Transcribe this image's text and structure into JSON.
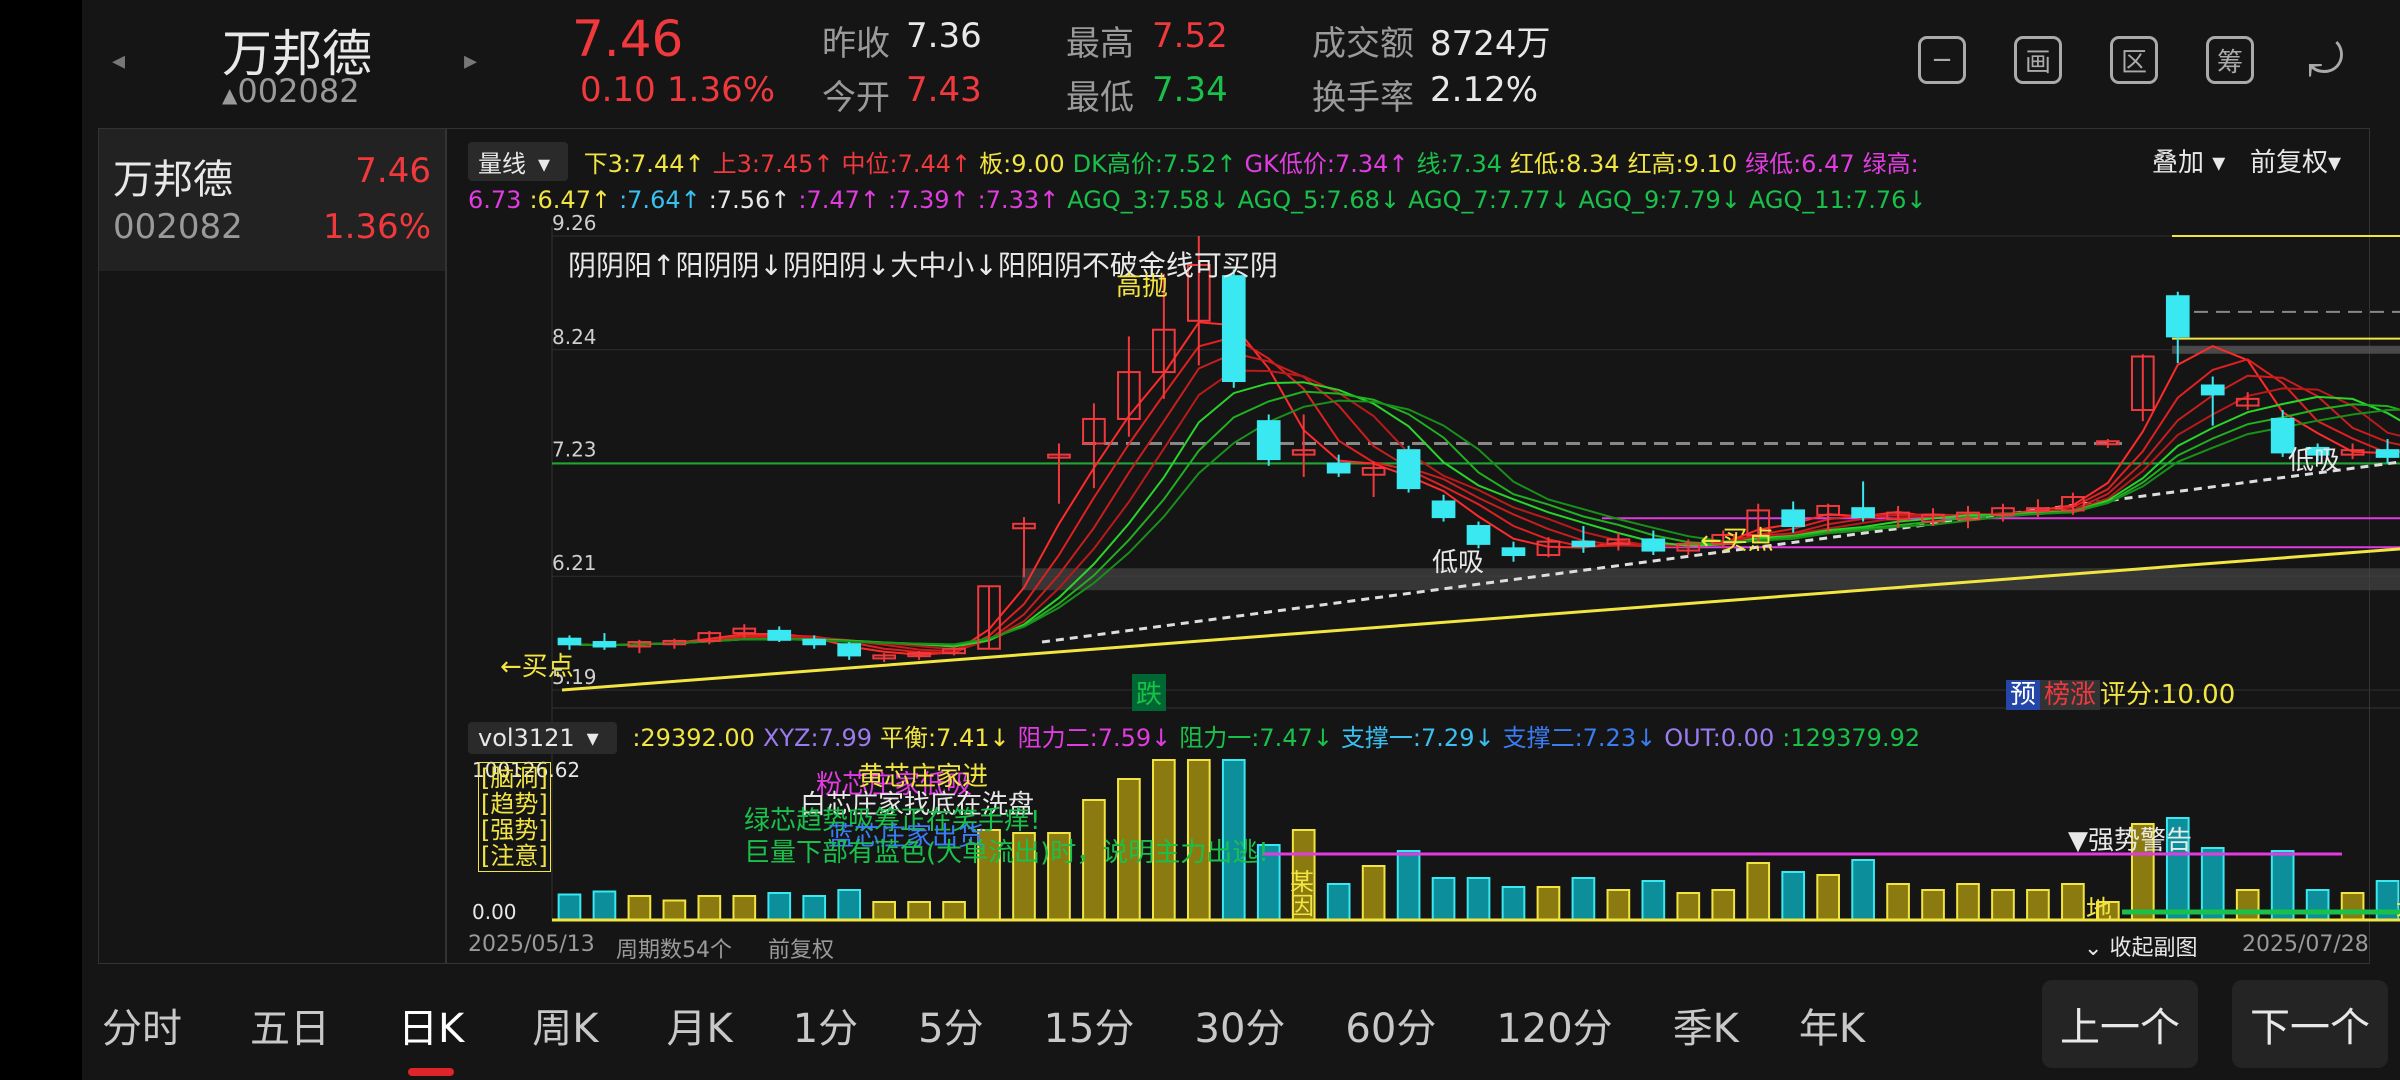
{
  "header": {
    "stock_name": "万邦德",
    "stock_code": "002082",
    "price": "7.46",
    "change": "0.10",
    "change_pct": "1.36%",
    "prev_close_label": "昨收",
    "prev_close": "7.36",
    "open_label": "今开",
    "open": "7.43",
    "high_label": "最高",
    "high": "7.52",
    "low_label": "最低",
    "low": "7.34",
    "turnover_label": "成交额",
    "turnover": "8724万",
    "turnover_rate_label": "换手率",
    "turnover_rate": "2.12%",
    "toolbar_icons": [
      {
        "name": "collapse-icon",
        "glyph": "−"
      },
      {
        "name": "draw-icon",
        "glyph": "画"
      },
      {
        "name": "range-icon",
        "glyph": "区"
      },
      {
        "name": "chip-icon",
        "glyph": "筹"
      },
      {
        "name": "rotate-screen-icon",
        "glyph": "⤾"
      }
    ]
  },
  "watchlist": {
    "items": [
      {
        "name": "万邦德",
        "code": "002082",
        "price": "7.46",
        "change_pct": "1.36%"
      }
    ]
  },
  "main_chart": {
    "indicator_selector": "量线",
    "overlay_label": "叠加",
    "adjust_label": "前复权",
    "line1": [
      {
        "text": "下3:7.44↑",
        "color": "#f2e542"
      },
      {
        "text": "上3:7.45↑",
        "color": "#f0393d"
      },
      {
        "text": "中位:7.44↑",
        "color": "#f0393d"
      },
      {
        "text": "板:9.00",
        "color": "#f2e542"
      },
      {
        "text": "DK高价:7.52↑",
        "color": "#19c14a"
      },
      {
        "text": "GK低价:7.34↑",
        "color": "#e03ce0"
      },
      {
        "text": "线:7.34",
        "color": "#19c14a"
      },
      {
        "text": "红低:8.34",
        "color": "#f2e542"
      },
      {
        "text": "红高:9.10",
        "color": "#f2e542"
      },
      {
        "text": "绿低:6.47",
        "color": "#e03ce0"
      },
      {
        "text": "绿高:",
        "color": "#e03ce0"
      }
    ],
    "line2": [
      {
        "text": "6.73",
        "color": "#e03ce0"
      },
      {
        "text": ":6.47↑",
        "color": "#f2e542"
      },
      {
        "text": ":7.64↑",
        "color": "#39c0f0"
      },
      {
        "text": ":7.56↑",
        "color": "#e8e8e8"
      },
      {
        "text": ":7.47↑",
        "color": "#e03ce0"
      },
      {
        "text": ":7.39↑",
        "color": "#e03ce0"
      },
      {
        "text": ":7.33↑",
        "color": "#e03ce0"
      },
      {
        "text": "AGQ_3:7.58↓",
        "color": "#19c14a"
      },
      {
        "text": "AGQ_5:7.68↓",
        "color": "#19c14a"
      },
      {
        "text": "AGQ_7:7.77↓",
        "color": "#19c14a"
      },
      {
        "text": "AGQ_9:7.79↓",
        "color": "#19c14a"
      },
      {
        "text": "AGQ_11:7.76↓",
        "color": "#19c14a"
      }
    ],
    "y_ticks": [
      "9.26",
      "8.24",
      "7.23",
      "6.21",
      "5.19"
    ],
    "annotation_top": "阴阴阳↑阳阴阴↓阴阳阴↓大中小↓阳阳阴不破金线可买阴",
    "label_high_throw": "高抛",
    "label_low_buy": "低吸",
    "label_low_buy_right": "低吸",
    "label_buy1": "←买点",
    "label_buy2": "←买点",
    "label_fall": "跌",
    "label_pre": "预",
    "label_rank": "榜涨",
    "score_label": "评分:",
    "score": "10.00"
  },
  "sub_chart": {
    "selector": "vol3121",
    "values": [
      {
        "text": ":29392.00",
        "color": "#f2e542"
      },
      {
        "text": "XYZ:7.99",
        "color": "#9b7cf0"
      },
      {
        "text": "平衡:7.41↓",
        "color": "#f2e542"
      },
      {
        "text": "阻力二:7.59↓",
        "color": "#e03ce0"
      },
      {
        "text": "阻力一:7.47↓",
        "color": "#19c14a"
      },
      {
        "text": "支撑一:7.29↓",
        "color": "#39c0f0"
      },
      {
        "text": "支撑二:7.23↓",
        "color": "#3a7cf3"
      },
      {
        "text": "OUT:0.00",
        "color": "#9b7cf0"
      },
      {
        "text": ":129379.92",
        "color": "#19c14a"
      }
    ],
    "y_top": "100126.62",
    "y_bottom": "0.00",
    "legend_box": [
      "[脑洞]",
      "[趋势]",
      "[强势]",
      "[注意]"
    ],
    "note_yellow": "黄芯庄家进",
    "note_magenta": "粉芯庄家低吸",
    "note_white": "白芯庄家找底在洗盘",
    "note_green1": "绿芯趋势吸筹正在笑手痒!",
    "note_blue": "蓝芯庄家出货",
    "note_green2": "巨量下部有蓝色(大单流出)时，说明主力出逃!",
    "label_strong_warning": "▼强势警告",
    "label_di1": "地",
    "label_di2": "地",
    "label_special": "某",
    "label_special2": "因"
  },
  "footer_row": {
    "start_date": "2025/05/13",
    "period_count": "周期数54个",
    "adjust": "前复权",
    "collapse_sub": "收起副图",
    "end_date": "2025/07/28"
  },
  "tabs": {
    "items": [
      "分时",
      "五日",
      "日K",
      "周K",
      "月K",
      "1分",
      "5分",
      "15分",
      "30分",
      "60分",
      "120分",
      "季K",
      "年K"
    ],
    "active": "日K",
    "prev_label": "上一个",
    "next_label": "下一个"
  },
  "colors": {
    "up": "#f0393d",
    "down": "#19c14a",
    "accent_yellow": "#f2e542",
    "cyan": "#39e8f0",
    "background": "#151515"
  },
  "chart_data": {
    "type": "bar",
    "title": "",
    "ylim": [
      5.19,
      9.26
    ],
    "x_range": [
      "2025/05/13",
      "2025/07/28"
    ],
    "y_ticks": [
      9.26,
      8.24,
      7.23,
      6.21,
      5.19
    ],
    "candles": [
      {
        "o": 5.65,
        "h": 5.68,
        "l": 5.55,
        "c": 5.6,
        "up": false
      },
      {
        "o": 5.62,
        "h": 5.7,
        "l": 5.55,
        "c": 5.58,
        "up": false
      },
      {
        "o": 5.58,
        "h": 5.64,
        "l": 5.52,
        "c": 5.62,
        "up": true
      },
      {
        "o": 5.6,
        "h": 5.65,
        "l": 5.56,
        "c": 5.63,
        "up": true
      },
      {
        "o": 5.63,
        "h": 5.72,
        "l": 5.6,
        "c": 5.7,
        "up": true
      },
      {
        "o": 5.7,
        "h": 5.78,
        "l": 5.66,
        "c": 5.74,
        "up": true
      },
      {
        "o": 5.72,
        "h": 5.76,
        "l": 5.62,
        "c": 5.64,
        "up": false
      },
      {
        "o": 5.64,
        "h": 5.68,
        "l": 5.56,
        "c": 5.6,
        "up": false
      },
      {
        "o": 5.6,
        "h": 5.62,
        "l": 5.46,
        "c": 5.5,
        "up": false
      },
      {
        "o": 5.48,
        "h": 5.52,
        "l": 5.44,
        "c": 5.5,
        "up": true
      },
      {
        "o": 5.5,
        "h": 5.54,
        "l": 5.46,
        "c": 5.52,
        "up": true
      },
      {
        "o": 5.52,
        "h": 5.58,
        "l": 5.5,
        "c": 5.56,
        "up": true
      },
      {
        "o": 5.56,
        "h": 6.12,
        "l": 5.56,
        "c": 6.12,
        "up": true
      },
      {
        "o": 6.68,
        "h": 6.74,
        "l": 6.2,
        "c": 6.64,
        "up": true
      },
      {
        "o": 7.3,
        "h": 7.4,
        "l": 6.86,
        "c": 7.28,
        "up": true
      },
      {
        "o": 7.4,
        "h": 7.76,
        "l": 7.0,
        "c": 7.62,
        "up": true
      },
      {
        "o": 7.62,
        "h": 8.36,
        "l": 7.46,
        "c": 8.04,
        "up": true
      },
      {
        "o": 8.04,
        "h": 8.92,
        "l": 7.8,
        "c": 8.42,
        "up": true
      },
      {
        "o": 8.5,
        "h": 9.26,
        "l": 8.1,
        "c": 9.0,
        "up": true
      },
      {
        "o": 8.9,
        "h": 8.96,
        "l": 7.9,
        "c": 7.96,
        "up": false
      },
      {
        "o": 7.6,
        "h": 7.66,
        "l": 7.2,
        "c": 7.26,
        "up": false
      },
      {
        "o": 7.3,
        "h": 7.66,
        "l": 7.1,
        "c": 7.34,
        "up": true
      },
      {
        "o": 7.22,
        "h": 7.3,
        "l": 7.1,
        "c": 7.14,
        "up": false
      },
      {
        "o": 7.12,
        "h": 7.24,
        "l": 6.92,
        "c": 7.18,
        "up": true
      },
      {
        "o": 7.34,
        "h": 7.38,
        "l": 6.96,
        "c": 7.0,
        "up": false
      },
      {
        "o": 6.88,
        "h": 6.94,
        "l": 6.7,
        "c": 6.74,
        "up": false
      },
      {
        "o": 6.66,
        "h": 6.7,
        "l": 6.46,
        "c": 6.5,
        "up": false
      },
      {
        "o": 6.46,
        "h": 6.52,
        "l": 6.34,
        "c": 6.4,
        "up": false
      },
      {
        "o": 6.4,
        "h": 6.56,
        "l": 6.38,
        "c": 6.52,
        "up": true
      },
      {
        "o": 6.52,
        "h": 6.66,
        "l": 6.42,
        "c": 6.48,
        "up": false
      },
      {
        "o": 6.5,
        "h": 6.6,
        "l": 6.44,
        "c": 6.54,
        "up": true
      },
      {
        "o": 6.54,
        "h": 6.62,
        "l": 6.4,
        "c": 6.44,
        "up": false
      },
      {
        "o": 6.44,
        "h": 6.54,
        "l": 6.4,
        "c": 6.5,
        "up": true
      },
      {
        "o": 6.5,
        "h": 6.62,
        "l": 6.46,
        "c": 6.58,
        "up": true
      },
      {
        "o": 6.58,
        "h": 6.86,
        "l": 6.52,
        "c": 6.8,
        "up": true
      },
      {
        "o": 6.8,
        "h": 6.88,
        "l": 6.6,
        "c": 6.66,
        "up": false
      },
      {
        "o": 6.76,
        "h": 6.86,
        "l": 6.6,
        "c": 6.84,
        "up": true
      },
      {
        "o": 6.82,
        "h": 7.06,
        "l": 6.7,
        "c": 6.74,
        "up": false
      },
      {
        "o": 6.72,
        "h": 6.84,
        "l": 6.64,
        "c": 6.78,
        "up": true
      },
      {
        "o": 6.76,
        "h": 6.82,
        "l": 6.66,
        "c": 6.7,
        "up": true
      },
      {
        "o": 6.72,
        "h": 6.84,
        "l": 6.64,
        "c": 6.78,
        "up": true
      },
      {
        "o": 6.76,
        "h": 6.86,
        "l": 6.7,
        "c": 6.82,
        "up": true
      },
      {
        "o": 6.82,
        "h": 6.9,
        "l": 6.74,
        "c": 6.8,
        "up": true
      },
      {
        "o": 6.8,
        "h": 6.96,
        "l": 6.76,
        "c": 6.92,
        "up": true
      },
      {
        "o": 7.4,
        "h": 7.44,
        "l": 7.36,
        "c": 7.42,
        "up": true
      },
      {
        "o": 7.7,
        "h": 8.2,
        "l": 7.6,
        "c": 8.18,
        "up": true
      },
      {
        "o": 8.36,
        "h": 8.76,
        "l": 8.12,
        "c": 8.72,
        "up": false
      },
      {
        "o": 7.84,
        "h": 8.0,
        "l": 7.56,
        "c": 7.92,
        "up": false
      },
      {
        "o": 7.74,
        "h": 7.86,
        "l": 7.7,
        "c": 7.8,
        "up": true
      },
      {
        "o": 7.62,
        "h": 7.7,
        "l": 7.28,
        "c": 7.32,
        "up": false
      },
      {
        "o": 7.3,
        "h": 7.4,
        "l": 7.24,
        "c": 7.36,
        "up": false
      },
      {
        "o": 7.34,
        "h": 7.4,
        "l": 7.26,
        "c": 7.3,
        "up": true
      },
      {
        "o": 7.34,
        "h": 7.44,
        "l": 7.22,
        "c": 7.28,
        "up": false
      },
      {
        "o": 7.43,
        "h": 7.52,
        "l": 7.34,
        "c": 7.46,
        "up": true
      }
    ]
  }
}
